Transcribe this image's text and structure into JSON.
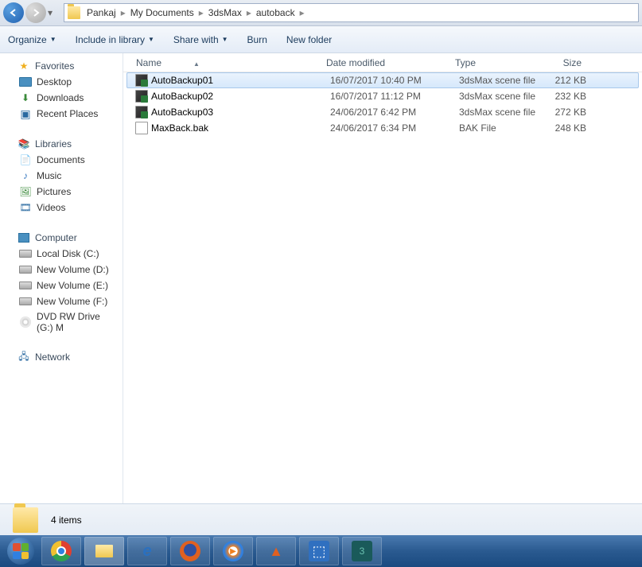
{
  "breadcrumb": [
    "Pankaj",
    "My Documents",
    "3dsMax",
    "autoback"
  ],
  "toolbar": {
    "organize": "Organize",
    "include": "Include in library",
    "share": "Share with",
    "burn": "Burn",
    "newfolder": "New folder"
  },
  "sidebar": {
    "favorites": {
      "label": "Favorites",
      "items": [
        "Desktop",
        "Downloads",
        "Recent Places"
      ]
    },
    "libraries": {
      "label": "Libraries",
      "items": [
        "Documents",
        "Music",
        "Pictures",
        "Videos"
      ]
    },
    "computer": {
      "label": "Computer",
      "items": [
        "Local Disk (C:)",
        "New Volume (D:)",
        "New Volume (E:)",
        "New Volume (F:)",
        "DVD RW Drive (G:) M"
      ]
    },
    "network": {
      "label": "Network"
    }
  },
  "columns": {
    "name": "Name",
    "date": "Date modified",
    "type": "Type",
    "size": "Size"
  },
  "files": [
    {
      "name": "AutoBackup01",
      "date": "16/07/2017 10:40 PM",
      "type": "3dsMax scene file",
      "size": "212 KB",
      "icon": "max",
      "selected": true
    },
    {
      "name": "AutoBackup02",
      "date": "16/07/2017 11:12 PM",
      "type": "3dsMax scene file",
      "size": "232 KB",
      "icon": "max",
      "selected": false
    },
    {
      "name": "AutoBackup03",
      "date": "24/06/2017 6:42 PM",
      "type": "3dsMax scene file",
      "size": "272 KB",
      "icon": "max",
      "selected": false
    },
    {
      "name": "MaxBack.bak",
      "date": "24/06/2017 6:34 PM",
      "type": "BAK File",
      "size": "248 KB",
      "icon": "blank",
      "selected": false
    }
  ],
  "status": {
    "count": "4 items"
  }
}
